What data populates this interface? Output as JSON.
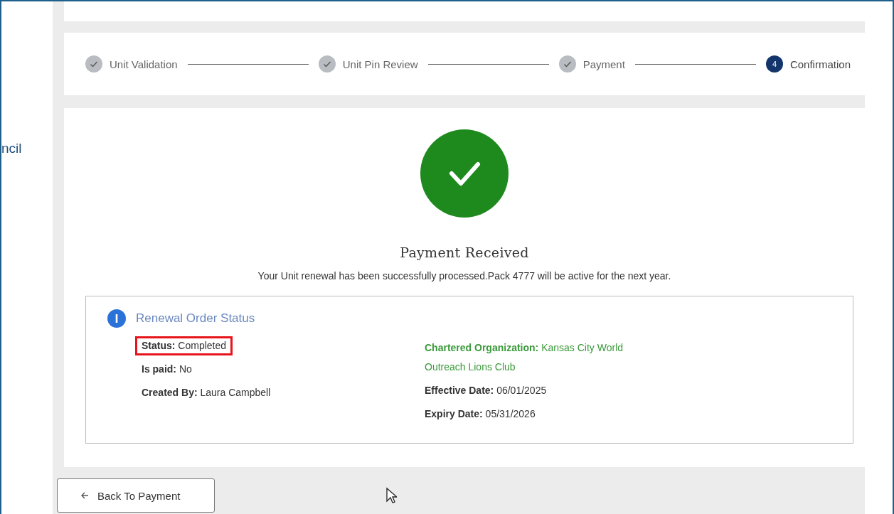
{
  "sidebar": {
    "text": "ncil"
  },
  "steps": [
    {
      "label": "Unit Validation",
      "kind": "done"
    },
    {
      "label": "Unit Pin Review",
      "kind": "done"
    },
    {
      "label": "Payment",
      "kind": "done"
    },
    {
      "label": "Confirmation",
      "kind": "current",
      "number": "4"
    }
  ],
  "result": {
    "title": "Payment Received",
    "message": "Your Unit renewal has been successfully processed.Pack 4777 will be active for the next year."
  },
  "order_status": {
    "title": "Renewal Order Status",
    "left_fields": [
      {
        "label": "Status:",
        "value": "Completed",
        "highlighted": true
      },
      {
        "label": "Is paid:",
        "value": "No",
        "highlighted": false
      },
      {
        "label": "Created By:",
        "value": "Laura Campbell",
        "highlighted": false
      }
    ],
    "right_fields": [
      {
        "label": "Chartered Organization:",
        "value": "Kansas City World Outreach Lions Club",
        "highlighted": false,
        "color": "#3a9a3a"
      },
      {
        "label": "Effective Date:",
        "value": "06/01/2025",
        "highlighted": false,
        "color": "#333333"
      },
      {
        "label": "Expiry Date:",
        "value": "05/31/2026",
        "highlighted": false,
        "color": "#333333"
      }
    ]
  },
  "back_button": {
    "label": "Back To Payment"
  }
}
